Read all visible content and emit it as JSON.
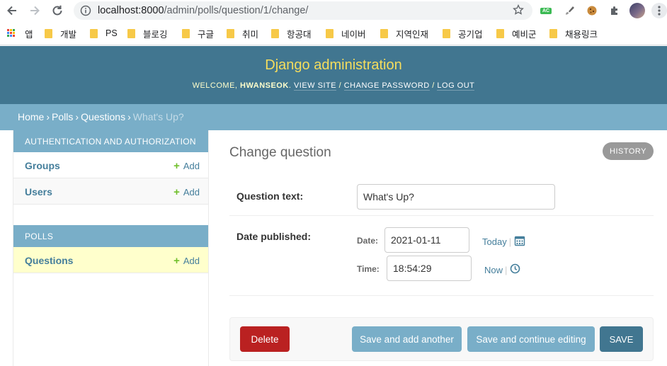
{
  "browser": {
    "url_host": "localhost:8000",
    "url_path": "/admin/polls/question/1/change/",
    "extension_badge": "AC",
    "bookmarks": [
      {
        "label": "앱",
        "type": "apps"
      },
      {
        "label": "개발",
        "type": "folder"
      },
      {
        "label": "PS",
        "type": "folder"
      },
      {
        "label": "블로깅",
        "type": "folder"
      },
      {
        "label": "구글",
        "type": "folder"
      },
      {
        "label": "취미",
        "type": "folder"
      },
      {
        "label": "항공대",
        "type": "folder"
      },
      {
        "label": "네이버",
        "type": "folder"
      },
      {
        "label": "지역인재",
        "type": "folder"
      },
      {
        "label": "공기업",
        "type": "folder"
      },
      {
        "label": "예비군",
        "type": "folder"
      },
      {
        "label": "채용링크",
        "type": "folder"
      }
    ]
  },
  "header": {
    "brand": "Django administration",
    "welcome": "Welcome, ",
    "username": "hwanseok",
    "view_site": "View site",
    "change_password": "Change password",
    "log_out": "Log out"
  },
  "breadcrumbs": {
    "home": "Home",
    "polls": "Polls",
    "questions": "Questions",
    "current": "What's Up?"
  },
  "sidebar": {
    "auth_caption": "AUTHENTICATION AND AUTHORIZATION",
    "groups": "Groups",
    "users": "Users",
    "polls_caption": "POLLS",
    "questions": "Questions",
    "add_label": "Add"
  },
  "content": {
    "title": "Change question",
    "history": "HISTORY",
    "question_text_label": "Question text:",
    "question_text_value": "What's Up?",
    "date_published_label": "Date published:",
    "date_label": "Date:",
    "date_value": "2021-01-11",
    "today_link": "Today",
    "time_label": "Time:",
    "time_value": "18:54:29",
    "now_link": "Now"
  },
  "submit": {
    "delete": "Delete",
    "save_add_another": "Save and add another",
    "save_continue": "Save and continue editing",
    "save": "SAVE"
  },
  "colors": {
    "header_bg": "#417690",
    "brand_yellow": "#f5dd5d",
    "breadcrumbs_bg": "#79aec8",
    "link": "#447e9b",
    "delete_red": "#ba2121",
    "add_green": "#70bf2b",
    "current_row": "#ffffcc"
  }
}
